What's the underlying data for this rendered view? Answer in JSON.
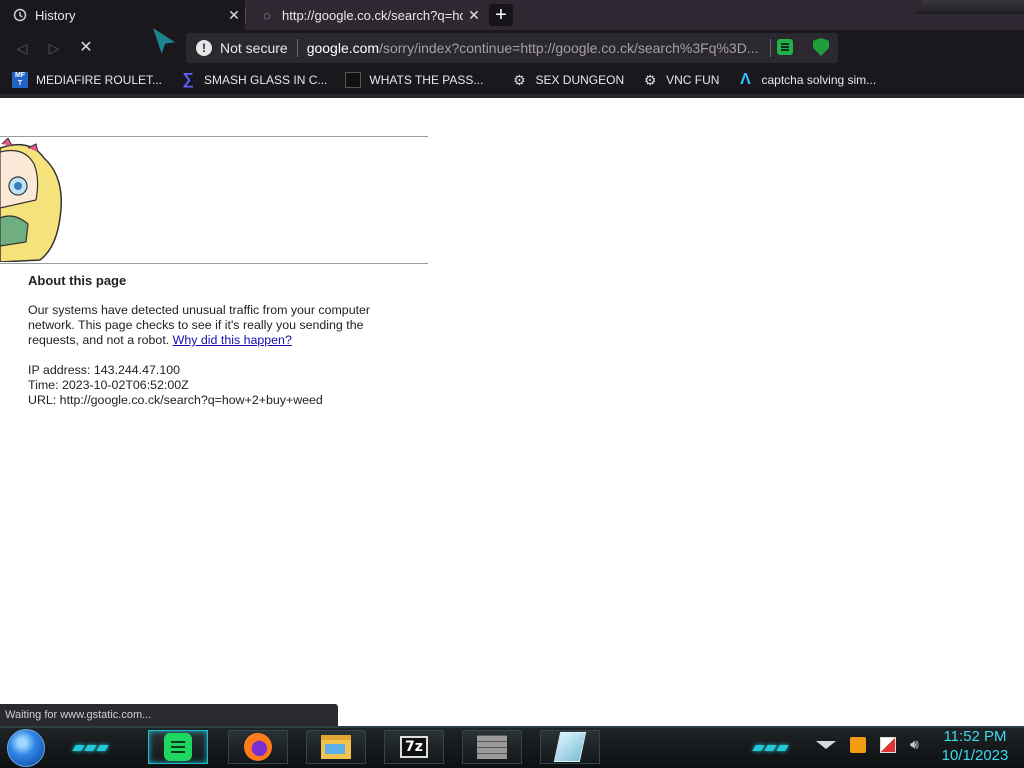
{
  "browser": {
    "tabs": [
      {
        "title": "History",
        "active": true
      },
      {
        "title": "http://google.co.ck/search?q=how",
        "active": false
      }
    ],
    "new_tab_label": "+",
    "omnibox": {
      "security_label": "Not secure",
      "host": "google.com",
      "path": "/sorry/index?continue=http://google.co.ck/search%3Fq%3D..."
    },
    "bookmarks": [
      {
        "label": "MEDIAFIRE ROULET...",
        "icon": "mediafire-icon"
      },
      {
        "label": "SMASH GLASS IN C...",
        "icon": "smash-glass-icon"
      },
      {
        "label": "WHATS THE PASS...",
        "icon": "whats-the-pass-icon"
      },
      {
        "label": "SEX DUNGEON",
        "icon": "sex-dungeon-icon"
      },
      {
        "label": "VNC FUN",
        "icon": "vnc-fun-icon"
      },
      {
        "label": "captcha solving sim...",
        "icon": "captcha-icon"
      }
    ]
  },
  "page": {
    "about_title": "About this page",
    "message": "Our systems have detected unusual traffic from your computer network. This page checks to see if it's really you sending the requests, and not a robot.",
    "why_link": "Why did this happen?",
    "ip_line": "IP address: 143.244.47.100",
    "time_line": "Time: 2023-10-02T06:52:00Z",
    "url_line": "URL: http://google.co.ck/search?q=how+2+buy+weed"
  },
  "status_bar": "Waiting for www.gstatic.com...",
  "taskbar": {
    "apps": [
      "spotify-icon",
      "firefox-icon",
      "file-explorer-icon",
      "7zip-icon",
      "firewall-icon",
      "glass-app-icon"
    ],
    "seven_zip_label": "7z",
    "clock_time": "11:52 PM",
    "clock_date": "10/1/2023"
  },
  "colors": {
    "chrome_bg": "#1b181d",
    "tab_strip": "#2e2833",
    "link": "#1a0dab",
    "clock": "#3fd7ea"
  }
}
